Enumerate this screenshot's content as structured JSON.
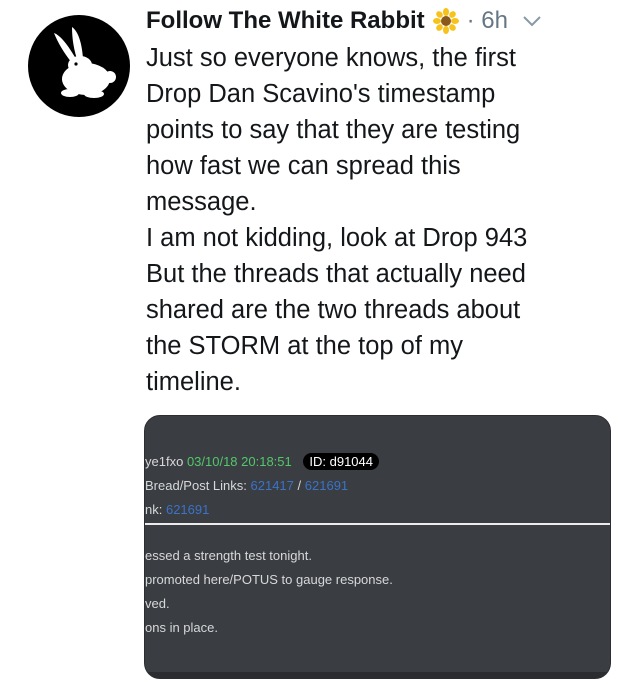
{
  "tweet": {
    "author_name": "Follow The White Rabbit",
    "time": "· 6h",
    "body": "Just so everyone knows, the first\nDrop Dan Scavino's timestamp\npoints to say that they are testing\nhow fast we can spread this\nmessage.\nI am not kidding, look at Drop 943\nBut the threads that actually need\nshared are the two threads about\nthe STORM at the top of my\ntimeline."
  },
  "icons": {
    "avatar": "white-rabbit-icon",
    "emoji": "sunflower-icon",
    "menu": "chevron-down-icon"
  },
  "media": {
    "line1_name": "ye1fxo",
    "line1_date": "03/10/18 20:18:51",
    "line1_id": "ID: d91044",
    "line2_label": "Bread/Post Links:",
    "line2_link1": "621417",
    "line2_sep": "/",
    "line2_link2": "621691",
    "line3_label": "nk:",
    "line3_link": "621691",
    "body_lines": [
      "essed a strength test tonight.",
      "promoted here/POTUS to gauge response.",
      "ved.",
      "ons in place."
    ]
  },
  "colors": {
    "text": "#14171a",
    "muted": "#657786",
    "media_bg": "#3a3d42",
    "green": "#52c86a",
    "link_blue": "#3b73c7"
  }
}
